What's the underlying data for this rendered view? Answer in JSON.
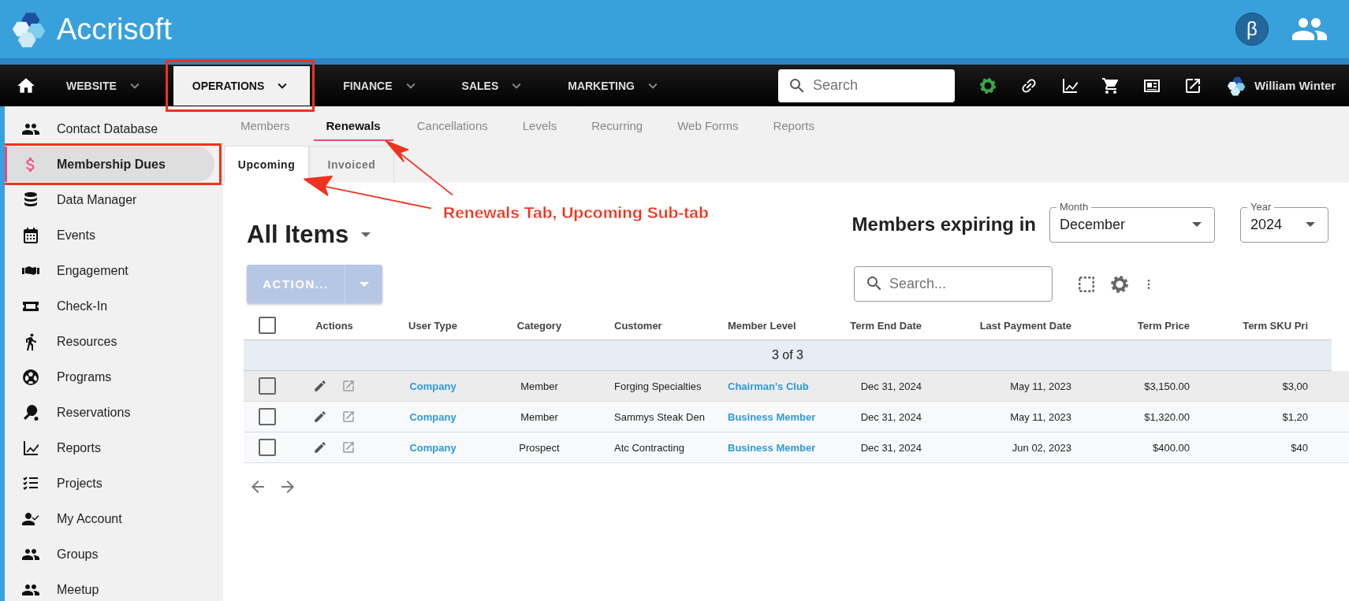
{
  "header": {
    "brand": "Accrisoft",
    "beta_badge": "β"
  },
  "nav": {
    "items": [
      {
        "label": "WEBSITE",
        "selected": false,
        "framed": false
      },
      {
        "label": "OPERATIONS",
        "selected": true,
        "framed": true
      },
      {
        "label": "FINANCE",
        "selected": false,
        "framed": false
      },
      {
        "label": "SALES",
        "selected": false,
        "framed": false
      },
      {
        "label": "MARKETING",
        "selected": false,
        "framed": false
      }
    ],
    "search": {
      "placeholder": "Search"
    },
    "user": "William Winter"
  },
  "sidebar": {
    "items": [
      {
        "label": "Contact Database",
        "selected": false,
        "framed": false
      },
      {
        "label": "Membership Dues",
        "selected": true,
        "framed": true
      },
      {
        "label": "Data Manager",
        "selected": false,
        "framed": false
      },
      {
        "label": "Events",
        "selected": false,
        "framed": false
      },
      {
        "label": "Engagement",
        "selected": false,
        "framed": false
      },
      {
        "label": "Check-In",
        "selected": false,
        "framed": false
      },
      {
        "label": "Resources",
        "selected": false,
        "framed": false
      },
      {
        "label": "Programs",
        "selected": false,
        "framed": false
      },
      {
        "label": "Reservations",
        "selected": false,
        "framed": false
      },
      {
        "label": "Reports",
        "selected": false,
        "framed": false
      },
      {
        "label": "Projects",
        "selected": false,
        "framed": false
      },
      {
        "label": "My Account",
        "selected": false,
        "framed": false
      },
      {
        "label": "Groups",
        "selected": false,
        "framed": false
      },
      {
        "label": "Meetup",
        "selected": false,
        "framed": false
      }
    ]
  },
  "tabs": [
    {
      "label": "Members",
      "selected": false
    },
    {
      "label": "Renewals",
      "selected": true
    },
    {
      "label": "Cancellations",
      "selected": false
    },
    {
      "label": "Levels",
      "selected": false
    },
    {
      "label": "Recurring",
      "selected": false
    },
    {
      "label": "Web Forms",
      "selected": false
    },
    {
      "label": "Reports",
      "selected": false
    }
  ],
  "sub_tabs": [
    {
      "label": "Upcoming",
      "selected": true
    },
    {
      "label": "Invoiced",
      "selected": false
    }
  ],
  "callout": "Renewals Tab, Upcoming Sub-tab",
  "view_title": "All Items",
  "expiring": {
    "label": "Members expiring in",
    "month": {
      "label": "Month",
      "value": "December"
    },
    "year": {
      "label": "Year",
      "value": "2024"
    }
  },
  "action_button": "ACTION...",
  "table_search": {
    "placeholder": "Search..."
  },
  "table": {
    "select_all_checked": false,
    "columns": [
      "Actions",
      "User Type",
      "Category",
      "Customer",
      "Member Level",
      "Term End Date",
      "Last Payment Date",
      "Term Price",
      "Term SKU Pri"
    ],
    "count": "3 of 3",
    "rows": [
      {
        "checked": false,
        "highlighted": true,
        "user_type": "Company",
        "category": "Member",
        "customer": "Forging Specialties",
        "member_level": "Chairman's Club",
        "term_end": "Dec 31, 2024",
        "last_payment": "May 11, 2023",
        "term_price": "$3,150.00",
        "term_sku_price": "$3,00"
      },
      {
        "checked": false,
        "highlighted": false,
        "user_type": "Company",
        "category": "Member",
        "customer": "Sammys Steak Den",
        "member_level": "Business Member",
        "term_end": "Dec 31, 2024",
        "last_payment": "May 11, 2023",
        "term_price": "$1,320.00",
        "term_sku_price": "$1,20"
      },
      {
        "checked": false,
        "highlighted": false,
        "user_type": "Company",
        "category": "Prospect",
        "customer": "Atc Contracting",
        "member_level": "Business Member",
        "term_end": "Dec 31, 2024",
        "last_payment": "Jun 02, 2023",
        "term_price": "$400.00",
        "term_sku_price": "$40"
      }
    ]
  }
}
